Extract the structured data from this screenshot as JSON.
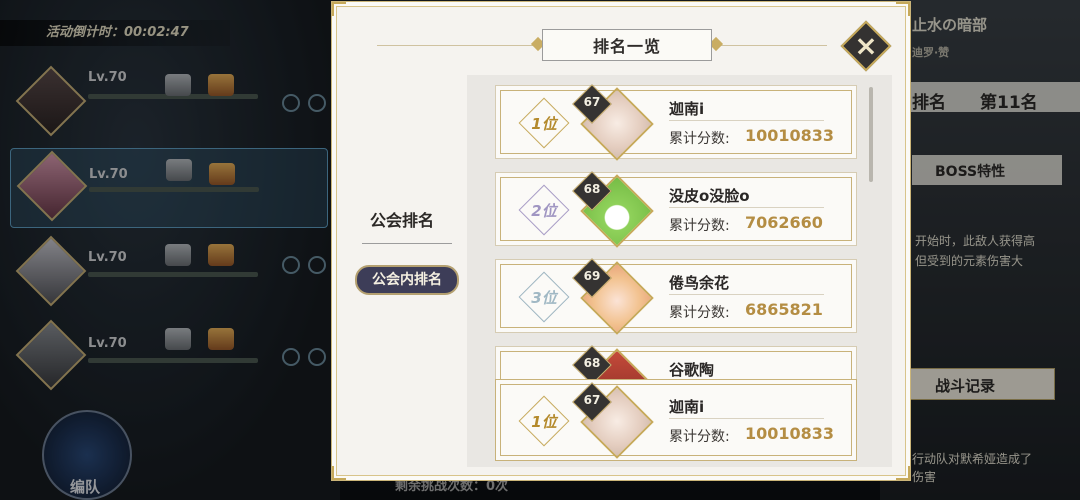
{
  "background": {
    "countdown_label": "活动倒计时：00:02:47",
    "team": [
      {
        "level": "Lv.70"
      },
      {
        "level": "Lv.70"
      },
      {
        "level": "Lv.70"
      },
      {
        "level": "Lv.70"
      }
    ],
    "edit_team_label": "编队",
    "remaining_label": "剩余挑战次数：0次",
    "right": {
      "boss_name": "止水の暗部",
      "boss_sub": "迪罗·赞",
      "rank_label": "排名",
      "rank_value": "第11名",
      "boss_trait_label": "BOSS特性",
      "trait_text_1": "开始时，此敌人获得高",
      "trait_text_2": "但受到的元素伤害大",
      "battle_record_label": "战斗记录",
      "record_text_1": "行动队对默希娅造成了",
      "record_text_2": "伤害"
    }
  },
  "modal": {
    "title": "排名一览",
    "close_icon": "close-x-icon",
    "tabs": [
      {
        "label": "公会排名",
        "active": false
      },
      {
        "label": "公会内排名",
        "active": true
      }
    ],
    "score_label": "累计分数:",
    "entries": [
      {
        "rank": "1位",
        "level": "67",
        "name": "迦南i",
        "score": "10010833",
        "avatar_color": "#e9d9cc"
      },
      {
        "rank": "2位",
        "level": "68",
        "name": "没皮o没脸o",
        "score": "7062660",
        "avatar_color": "#8fd15a"
      },
      {
        "rank": "3位",
        "level": "69",
        "name": "倦鸟余花",
        "score": "6865821",
        "avatar_color": "#f1c89a"
      },
      {
        "rank": "",
        "level": "68",
        "name": "谷歌陶",
        "score": "",
        "avatar_color": "#c44a3a"
      }
    ],
    "self_entry": {
      "rank": "1位",
      "level": "67",
      "name": "迦南i",
      "score": "10010833",
      "avatar_color": "#e9d9cc"
    }
  }
}
